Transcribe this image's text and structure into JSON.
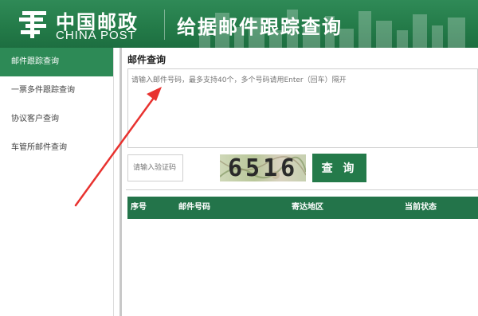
{
  "header": {
    "logo_cn": "中国邮政",
    "logo_en": "CHINA POST",
    "title": "给据邮件跟踪查询"
  },
  "sidebar": {
    "items": [
      {
        "label": "邮件跟踪查询",
        "active": true
      },
      {
        "label": "一票多件跟踪查询",
        "active": false
      },
      {
        "label": "协议客户查询",
        "active": false
      },
      {
        "label": "车管所邮件查询",
        "active": false
      }
    ]
  },
  "main": {
    "section_title": "邮件查询",
    "tracking_input": {
      "value": "",
      "placeholder": "请输入邮件号码，最多支持40个，多个号码请用Enter（回车）隔开"
    },
    "captcha_input": {
      "value": "",
      "placeholder": "请输入验证码"
    },
    "captcha_image_text": "6516",
    "query_button": "查 询"
  },
  "results_table": {
    "columns": [
      "序号",
      "邮件号码",
      "寄达地区",
      "当前状态"
    ],
    "rows": []
  },
  "colors": {
    "header_green": "#237a48",
    "sidebar_active": "#2d8a56",
    "button_green": "#247a4a",
    "table_head": "#23744a",
    "annotation_arrow": "#e8322f"
  },
  "icons": [
    "china-post-logo-icon",
    "red-arrow-annotation"
  ]
}
